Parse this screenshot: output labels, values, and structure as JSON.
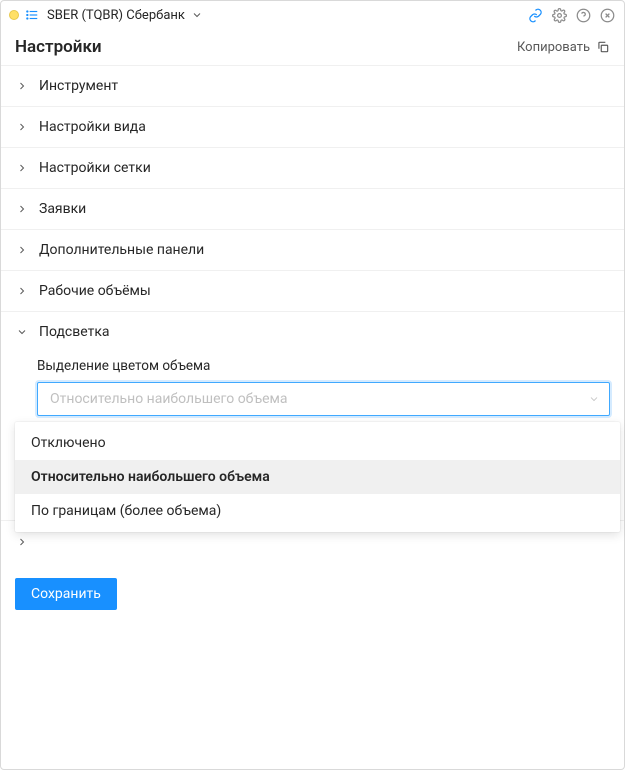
{
  "titlebar": {
    "instrument": "SBER (TQBR) Сбербанк"
  },
  "header": {
    "title": "Настройки",
    "copy": "Копировать"
  },
  "sections": [
    {
      "label": "Инструмент",
      "expanded": false
    },
    {
      "label": "Настройки вида",
      "expanded": false
    },
    {
      "label": "Настройки сетки",
      "expanded": false
    },
    {
      "label": "Заявки",
      "expanded": false
    },
    {
      "label": "Дополнительные панели",
      "expanded": false
    },
    {
      "label": "Рабочие объёмы",
      "expanded": false
    },
    {
      "label": "Подсветка",
      "expanded": true
    }
  ],
  "highlight": {
    "field_label": "Выделение цветом объема",
    "selected": "Относительно наибольшего объема",
    "options": [
      "Отключено",
      "Относительно наибольшего объема",
      "По границам (более объема)"
    ]
  },
  "save_label": "Сохранить"
}
